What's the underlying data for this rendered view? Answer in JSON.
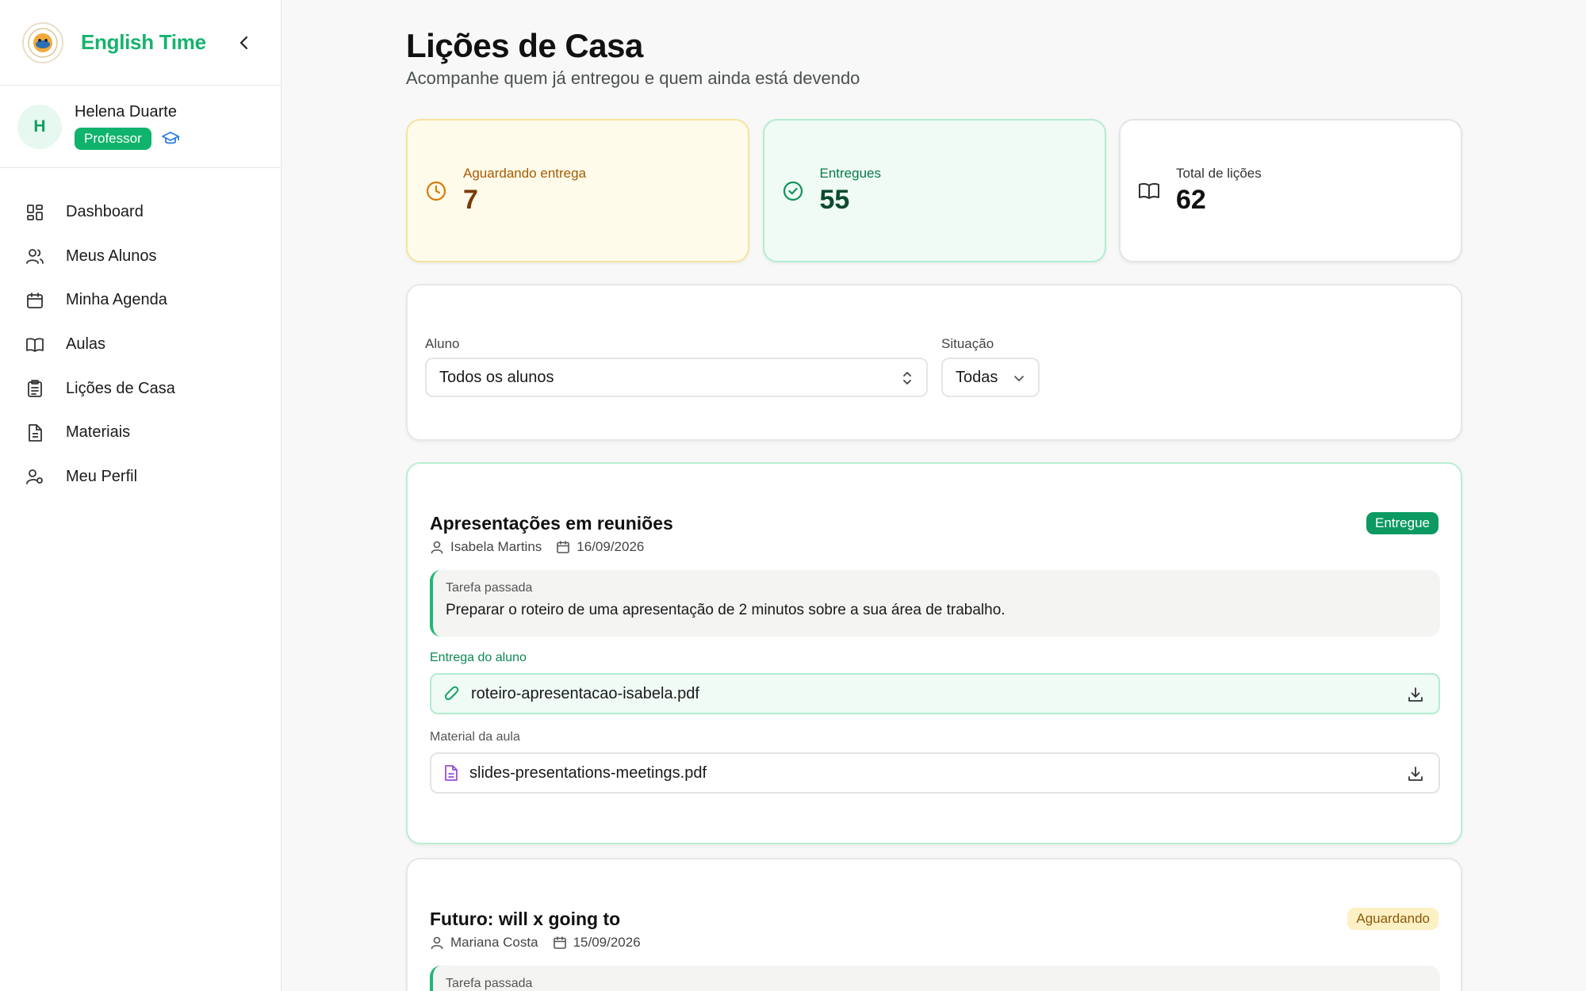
{
  "app": {
    "name": "English Time"
  },
  "user": {
    "initial": "H",
    "name": "Helena Duarte",
    "role": "Professor"
  },
  "nav": [
    {
      "label": "Dashboard",
      "icon": "dashboard-icon"
    },
    {
      "label": "Meus Alunos",
      "icon": "users-icon"
    },
    {
      "label": "Minha Agenda",
      "icon": "calendar-icon"
    },
    {
      "label": "Aulas",
      "icon": "book-icon"
    },
    {
      "label": "Lições de Casa",
      "icon": "clipboard-icon"
    },
    {
      "label": "Materiais",
      "icon": "file-icon"
    },
    {
      "label": "Meu Perfil",
      "icon": "user-cog-icon"
    }
  ],
  "page": {
    "title": "Lições de Casa",
    "subtitle": "Acompanhe quem já entregou e quem ainda está devendo"
  },
  "stats": {
    "pending": {
      "label": "Aguardando entrega",
      "value": "7"
    },
    "delivered": {
      "label": "Entregues",
      "value": "55"
    },
    "total": {
      "label": "Total de lições",
      "value": "62"
    }
  },
  "filters": {
    "student_label": "Aluno",
    "student_value": "Todos os alunos",
    "status_label": "Situação",
    "status_value": "Todas"
  },
  "homeworks": [
    {
      "title": "Apresentações em reuniões",
      "student": "Isabela Martins",
      "date": "16/09/2026",
      "status": "Entregue",
      "task_label": "Tarefa passada",
      "task_text": "Preparar o roteiro de uma apresentação de 2 minutos sobre a sua área de trabalho.",
      "delivery_label": "Entrega do aluno",
      "delivery_file": "roteiro-apresentacao-isabela.pdf",
      "material_label": "Material da aula",
      "material_file": "slides-presentations-meetings.pdf"
    },
    {
      "title": "Futuro: will x going to",
      "student": "Mariana Costa",
      "date": "15/09/2026",
      "status": "Aguardando",
      "task_label": "Tarefa passada"
    }
  ],
  "colors": {
    "brand": "#16b36e",
    "delivered": "#0c9a62",
    "pending": "#fdf0c4"
  }
}
